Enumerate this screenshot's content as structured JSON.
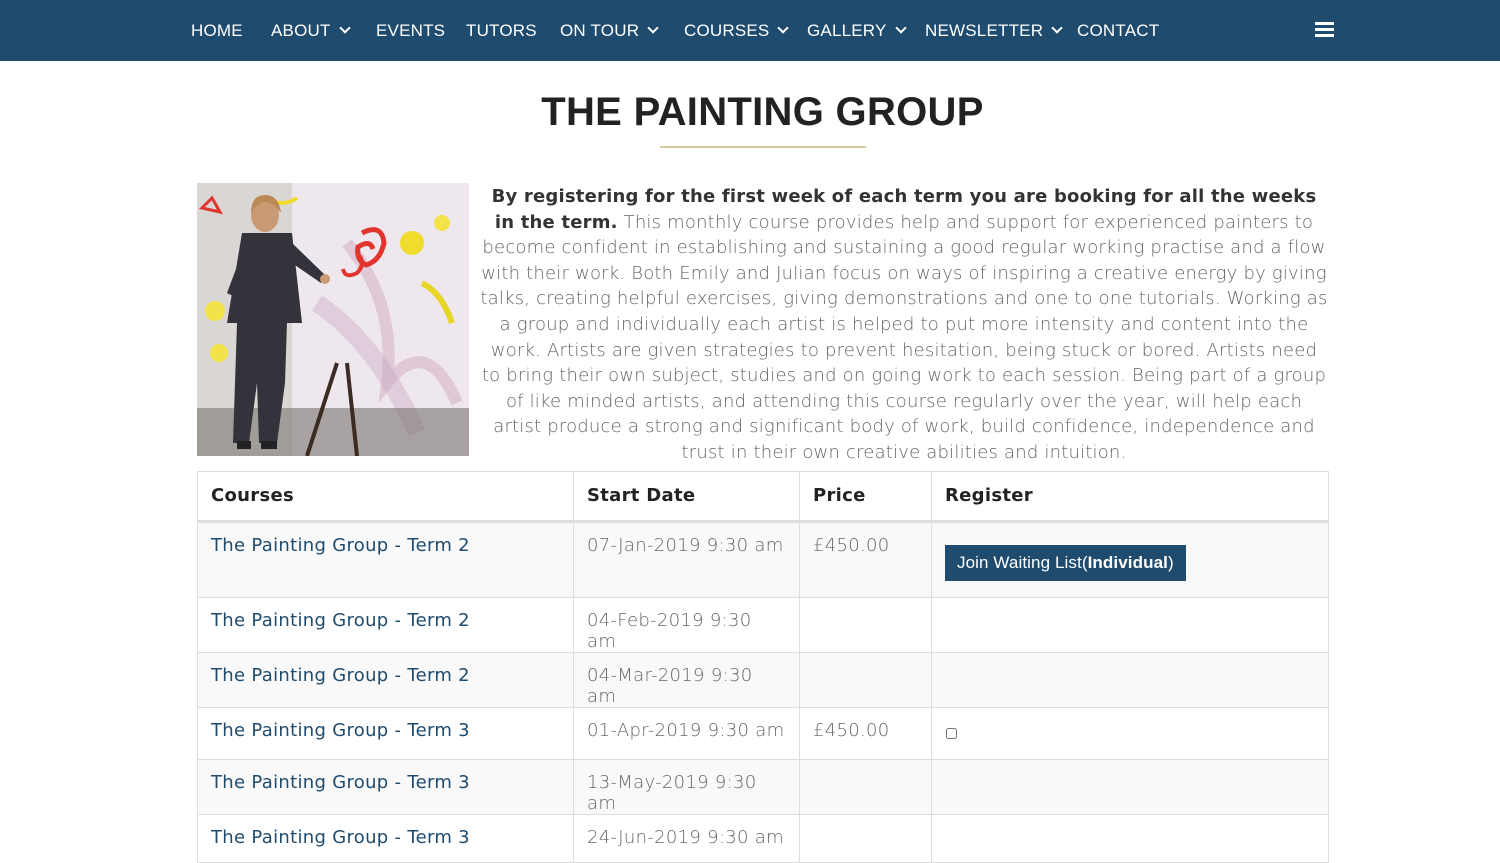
{
  "nav": {
    "items": [
      {
        "label": "HOME"
      },
      {
        "label": "ABOUT"
      },
      {
        "label": "EVENTS"
      },
      {
        "label": "TUTORS"
      },
      {
        "label": "ON TOUR"
      },
      {
        "label": "COURSES"
      },
      {
        "label": "GALLERY"
      },
      {
        "label": "NEWSLETTER"
      },
      {
        "label": "CONTACT"
      }
    ],
    "menu_icon": "hamburger-icon"
  },
  "page": {
    "title": "THE PAINTING GROUP",
    "photo_icon": "painter-at-canvas-photo",
    "intro_lead": "By registering for the first week of each term  you are booking for all the weeks in the term.",
    "intro_body": "This monthly course provides help and support for experienced painters to become confident in establishing and sustaining a good regular working practise and a flow with their work. Both Emily and Julian focus on ways of inspiring a creative energy by giving talks, creating helpful exercises, giving demonstrations and one to one tutorials. Working as a group and individually each artist is helped to put more intensity and content into the work. Artists are given strategies to prevent hesitation, being stuck or bored. Artists need to bring their own subject, studies and on going work to each session. Being part of a group of like minded artists, and attending this course regularly over the year, will help each artist produce a strong and significant body of work, build confidence, independence and trust in their own creative abilities and intuition."
  },
  "table": {
    "headers": [
      "Courses",
      "Start Date",
      "Price",
      "Register"
    ],
    "rows": [
      {
        "course": "The Painting Group - Term 2",
        "start": "07-Jan-2019 9:30 am",
        "price": "£450.00"
      },
      {
        "course": "The Painting Group - Term 2",
        "start": "04-Feb-2019 9:30 am",
        "price": ""
      },
      {
        "course": "The Painting Group - Term 2",
        "start": "04-Mar-2019 9:30 am",
        "price": ""
      },
      {
        "course": "The Painting Group - Term 3",
        "start": "01-Apr-2019 9:30 am",
        "price": "£450.00"
      },
      {
        "course": "The Painting Group - Term 3",
        "start": "13-May-2019 9:30 am",
        "price": ""
      },
      {
        "course": "The Painting Group - Term 3",
        "start": "24-Jun-2019 9:30 am",
        "price": ""
      }
    ],
    "waitlist_button": {
      "prefix": "Join Waiting List(",
      "bold": "Individual",
      "suffix": ")"
    }
  },
  "colors": {
    "nav_bg": "#1f4b6e",
    "link": "#1f4b6e",
    "accent_rule": "#d7c9a0"
  }
}
